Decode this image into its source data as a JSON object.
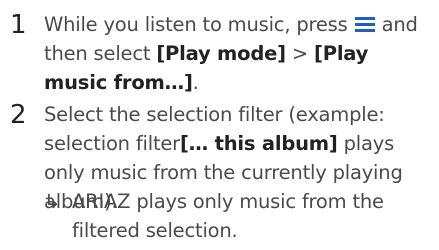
{
  "steps": [
    {
      "number": "1",
      "text_a": "While you listen to music, press",
      "icon": "menu-icon",
      "text_b": "and then select",
      "bold_1": "[Play mode]",
      "sep": ">",
      "bold_2": "[Play music from…]",
      "end": "."
    },
    {
      "number": "2",
      "text_a": "Select the selection filter (example: selection filter",
      "bold_1": "[… this album]",
      "text_b": "plays only music from the currently playing album).",
      "result_arrow": "↳",
      "result_text": "ARIAZ plays only music from the filtered selection."
    }
  ],
  "colors": {
    "icon": "#1f5fbf"
  }
}
